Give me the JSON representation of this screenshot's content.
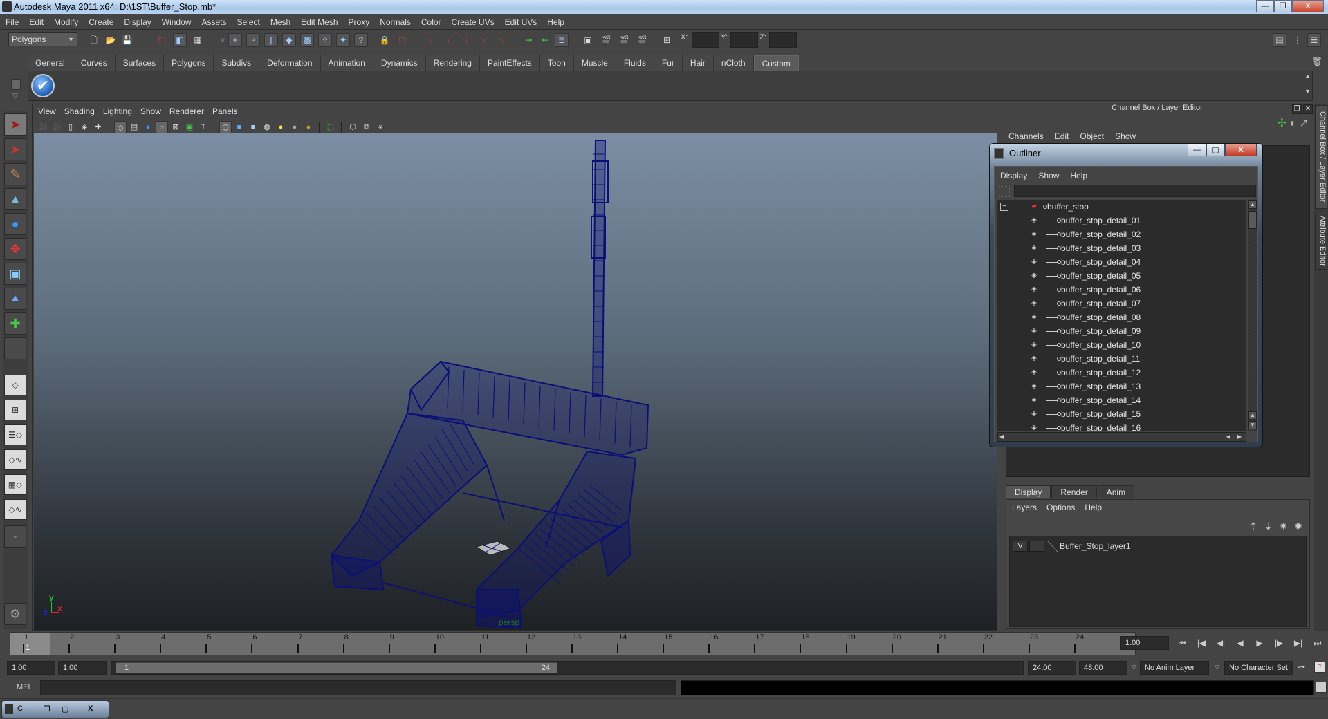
{
  "window": {
    "title": "Autodesk Maya 2011 x64: D:\\1ST\\Buffer_Stop.mb*",
    "buttons": {
      "minimize": "—",
      "maximize": "❐",
      "close": "X"
    }
  },
  "menubar": [
    "File",
    "Edit",
    "Modify",
    "Create",
    "Display",
    "Window",
    "Assets",
    "Select",
    "Mesh",
    "Edit Mesh",
    "Proxy",
    "Normals",
    "Color",
    "Create UVs",
    "Edit UVs",
    "Help"
  ],
  "statusline": {
    "menuset": "Polygons",
    "xyz_labels": [
      "X:",
      "Y:",
      "Z:"
    ]
  },
  "shelf": {
    "tabs": [
      "General",
      "Curves",
      "Surfaces",
      "Polygons",
      "Subdivs",
      "Deformation",
      "Animation",
      "Dynamics",
      "Rendering",
      "PaintEffects",
      "Toon",
      "Muscle",
      "Fluids",
      "Fur",
      "Hair",
      "nCloth",
      "Custom"
    ],
    "active_tab": "Custom",
    "items": [
      {
        "icon": "checkmark-icon",
        "glyph": "✔"
      }
    ]
  },
  "panel": {
    "menu": [
      "View",
      "Shading",
      "Lighting",
      "Show",
      "Renderer",
      "Panels"
    ],
    "camera_label": "persp",
    "axis": {
      "x": "x",
      "y": "y",
      "z": "z"
    }
  },
  "channelbox": {
    "title": "Channel Box / Layer Editor",
    "menu": [
      "Channels",
      "Edit",
      "Object",
      "Show"
    ]
  },
  "layer_editor": {
    "tabs": [
      "Display",
      "Render",
      "Anim"
    ],
    "active_tab": "Display",
    "menu": [
      "Layers",
      "Options",
      "Help"
    ],
    "layers": [
      {
        "visible": "V",
        "name": "Buffer_Stop_layer1"
      }
    ]
  },
  "side_tabs": [
    "Channel Box / Layer Editor",
    "Attribute Editor"
  ],
  "outliner": {
    "title": "Outliner",
    "menu": [
      "Display",
      "Show",
      "Help"
    ],
    "root": "buffer_stop",
    "children": [
      "buffer_stop_detail_01",
      "buffer_stop_detail_02",
      "buffer_stop_detail_03",
      "buffer_stop_detail_04",
      "buffer_stop_detail_05",
      "buffer_stop_detail_06",
      "buffer_stop_detail_07",
      "buffer_stop_detail_08",
      "buffer_stop_detail_09",
      "buffer_stop_detail_10",
      "buffer_stop_detail_11",
      "buffer_stop_detail_12",
      "buffer_stop_detail_13",
      "buffer_stop_detail_14",
      "buffer_stop_detail_15",
      "buffer_stop_detail_16"
    ]
  },
  "timeline": {
    "frames": [
      1,
      2,
      3,
      4,
      5,
      6,
      7,
      8,
      9,
      10,
      11,
      12,
      13,
      14,
      15,
      16,
      17,
      18,
      19,
      20,
      21,
      22,
      23,
      24
    ],
    "current_frame_marker": "1",
    "current_time": "1.00"
  },
  "playback": [
    "⏮",
    "|◀",
    "◀|",
    "◀",
    "▶",
    "|▶",
    "▶|",
    "⏭"
  ],
  "range": {
    "start_time": "1.00",
    "playback_start": "1.00",
    "range_start_label": "1",
    "range_end_label": "24",
    "playback_end": "24.00",
    "end_time": "48.00",
    "anim_layer": "No Anim Layer",
    "character_set": "No Character Set"
  },
  "command_line": {
    "label": "MEL",
    "value": ""
  },
  "minimized_window": {
    "label": "C..."
  },
  "colors": {
    "wireframe": "#0a0f78",
    "viewport_top": "#7c8ea3",
    "viewport_bottom": "#1e2124"
  }
}
